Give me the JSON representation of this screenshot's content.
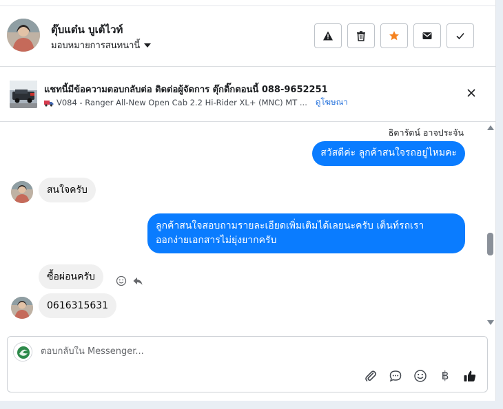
{
  "contact": {
    "name": "ตุ๊บแต๋น บูเต้ไวท์",
    "assign_label": "มอบหมายการสนทนานี้"
  },
  "actions": [
    {
      "name": "report-button",
      "icon": "warning-icon"
    },
    {
      "name": "delete-button",
      "icon": "trash-icon"
    },
    {
      "name": "star-button",
      "icon": "star-icon",
      "color": "#f5821f"
    },
    {
      "name": "mark-unread-button",
      "icon": "envelope-icon"
    },
    {
      "name": "mark-done-button",
      "icon": "check-icon"
    }
  ],
  "ad_banner": {
    "title": "แชทนี้มีข้อความตอบกลับต่อ ติดต่อผู้จัดการ ตุ๊กติ๊กตอนนี้ 088-9652251",
    "subtitle": "V084 - Ranger All-New Open Cab 2.2 Hi-Rider XL+ (MNC) MT ...",
    "link_label": "ดูโฆษณา"
  },
  "conversation": {
    "sender_name": "ธิดารัตน์ อาจประจัน",
    "messages": [
      {
        "direction": "outgoing",
        "text": "สวัสดีค่ะ ลูกค้าสนใจรถอยู่ไหมคะ"
      },
      {
        "direction": "incoming",
        "text": "สนใจครับ"
      },
      {
        "direction": "outgoing",
        "text": "ลูกค้าสนใจสอบถามรายละเอียดเพิ่มเติมได้เลยนะครับ เต็นท์รถเรา\nออกง่ายเอกสารไม่ยุ่งยากครับ"
      },
      {
        "direction": "incoming",
        "text": "ซื้อผ่อนครับ"
      },
      {
        "direction": "incoming",
        "text": "0616315631"
      }
    ]
  },
  "composer": {
    "placeholder": "ตอบกลับใน Messenger...",
    "currency_symbol": "฿"
  },
  "colors": {
    "outgoing_bubble": "#0a7cff",
    "incoming_bubble": "#f0f0f0",
    "star": "#f5821f",
    "link": "#216fdb"
  }
}
